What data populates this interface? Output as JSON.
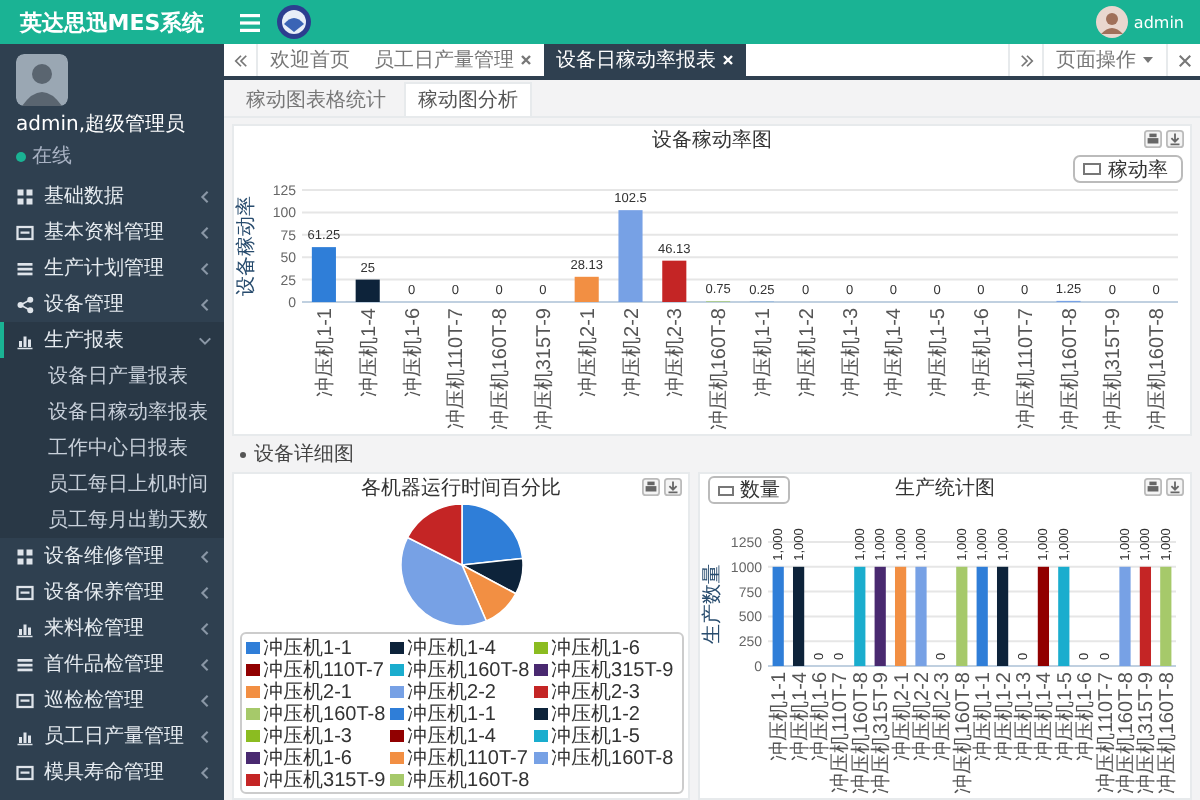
{
  "topbar": {
    "brand": "英达思迅MES系统",
    "user": "admin"
  },
  "sidebar": {
    "user": {
      "name": "admin,超级管理员",
      "status": "在线"
    },
    "menu": [
      {
        "label": "基础数据",
        "expanded": false
      },
      {
        "label": "基本资料管理",
        "expanded": false
      },
      {
        "label": "生产计划管理",
        "expanded": false
      },
      {
        "label": "设备管理",
        "expanded": false
      },
      {
        "label": "生产报表",
        "expanded": true,
        "children": [
          {
            "label": "设备日产量报表"
          },
          {
            "label": "设备日稼动率报表"
          },
          {
            "label": "工作中心日报表"
          },
          {
            "label": "员工每日上机时间"
          },
          {
            "label": "员工每月出勤天数"
          }
        ]
      },
      {
        "label": "设备维修管理",
        "expanded": false
      },
      {
        "label": "设备保养管理",
        "expanded": false
      },
      {
        "label": "来料检管理",
        "expanded": false
      },
      {
        "label": "首件品检管理",
        "expanded": false
      },
      {
        "label": "巡检检管理",
        "expanded": false
      },
      {
        "label": "员工日产量管理",
        "expanded": false
      },
      {
        "label": "模具寿命管理",
        "expanded": false
      }
    ]
  },
  "tabs": [
    {
      "label": "欢迎首页",
      "selected": false,
      "closable": false
    },
    {
      "label": "员工日产量管理",
      "selected": false,
      "closable": true
    },
    {
      "label": "设备日稼动率报表",
      "selected": true,
      "closable": true
    }
  ],
  "page_actions": "页面操作",
  "subtabs": [
    {
      "label": "稼动图表格统计",
      "selected": false
    },
    {
      "label": "稼动图分析",
      "selected": true
    }
  ],
  "utilization_chart": {
    "chart_data": {
      "type": "bar",
      "title": "设备稼动率图",
      "ylabel": "设备稼动率",
      "categories": [
        "冲压机1-1",
        "冲压机1-4",
        "冲压机1-6",
        "冲压机110T-7",
        "冲压机160T-8",
        "冲压机315T-9",
        "冲压机2-1",
        "冲压机2-2",
        "冲压机2-3",
        "冲压机160T-8",
        "冲压机1-1",
        "冲压机1-2",
        "冲压机1-3",
        "冲压机1-4",
        "冲压机1-5",
        "冲压机1-6",
        "冲压机110T-7",
        "冲压机160T-8",
        "冲压机315T-9",
        "冲压机160T-8"
      ],
      "series": [
        {
          "name": "稼动率",
          "values": [
            61.25,
            25,
            0,
            0,
            0,
            0,
            28.13,
            102.5,
            46.13,
            0.75,
            0.25,
            0,
            0,
            0,
            0,
            0,
            0,
            1.25,
            0,
            0
          ]
        }
      ],
      "ylim": [
        0,
        125
      ],
      "yticks": [
        0,
        25,
        50,
        75,
        100,
        125
      ],
      "grid": true,
      "data_labels": true
    }
  },
  "section": {
    "title": "设备详细图"
  },
  "runtime_chart": {
    "chart_data": {
      "type": "pie",
      "title": "各机器运行时间百分比",
      "categories": [
        "冲压机1-1",
        "冲压机1-4",
        "冲压机1-6",
        "冲压机110T-7",
        "冲压机160T-8",
        "冲压机315T-9",
        "冲压机2-1",
        "冲压机2-2",
        "冲压机2-3",
        "冲压机160T-8",
        "冲压机1-1",
        "冲压机1-2",
        "冲压机1-3",
        "冲压机1-4",
        "冲压机1-5",
        "冲压机1-6",
        "冲压机110T-7",
        "冲压机160T-8",
        "冲压机315T-9",
        "冲压机160T-8"
      ],
      "values": [
        23.29,
        9.5,
        0,
        0,
        0,
        0,
        10.69,
        38.98,
        17.54,
        0,
        0,
        0,
        0,
        0,
        0,
        0,
        0,
        0,
        0,
        0
      ],
      "legend": "bottom"
    }
  },
  "production_chart": {
    "chart_data": {
      "type": "bar",
      "title": "生产统计图",
      "ylabel": "生产数量",
      "categories": [
        "冲压机1-1",
        "冲压机1-4",
        "冲压机1-6",
        "冲压机110T-7",
        "冲压机160T-8",
        "冲压机315T-9",
        "冲压机2-1",
        "冲压机2-2",
        "冲压机2-3",
        "冲压机160T-8",
        "冲压机1-1",
        "冲压机1-2",
        "冲压机1-3",
        "冲压机1-4",
        "冲压机1-5",
        "冲压机1-6",
        "冲压机110T-7",
        "冲压机160T-8",
        "冲压机315T-9",
        "冲压机160T-8"
      ],
      "series": [
        {
          "name": "数量",
          "values": [
            1000,
            1000,
            0,
            0,
            1000,
            1000,
            1000,
            1000,
            0,
            1000,
            1000,
            1000,
            0,
            1000,
            1000,
            0,
            0,
            1000,
            1000,
            1000
          ]
        }
      ],
      "ylim": [
        0,
        1250
      ],
      "yticks": [
        0,
        250,
        500,
        750,
        1000,
        1250
      ],
      "grid": true,
      "value_labels": [
        "1,000",
        "1,000",
        "0",
        "0",
        "1,000",
        "1,000",
        "1,000",
        "1,000",
        "0",
        "1,000",
        "1,000",
        "1,000",
        "0",
        "1,000",
        "1,000",
        "0",
        "0",
        "1,000",
        "1,000",
        "1,000"
      ]
    }
  }
}
